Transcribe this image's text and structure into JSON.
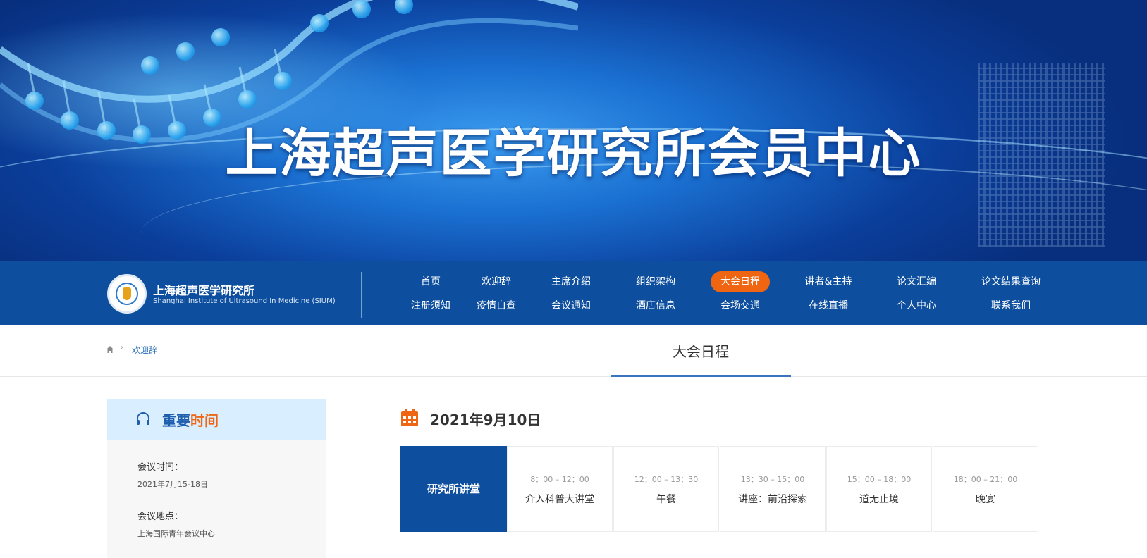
{
  "banner": {
    "title": "上海超声医学研究所会员中心"
  },
  "brand": {
    "name_cn": "上海超声医学研究所",
    "name_en": "Shanghai Institute of Ultrasound In Medicine (SIUM)"
  },
  "nav": {
    "row1": [
      "首页",
      "欢迎辞",
      "主席介绍",
      "组织架构",
      "大会日程",
      "讲者&主持",
      "论文汇编",
      "论文结果查询"
    ],
    "row2": [
      "注册须知",
      "疫情自查",
      "会议通知",
      "酒店信息",
      "会场交通",
      "在线直播",
      "个人中心",
      "联系我们"
    ],
    "active": "大会日程"
  },
  "breadcrumb": {
    "current": "欢迎辞"
  },
  "section": {
    "title": "大会日程"
  },
  "sidebar": {
    "title_part1": "重要",
    "title_part2": "时间",
    "items": [
      {
        "label": "会议时间：",
        "value": "2021年7月15-18日"
      },
      {
        "label": "会议地点：",
        "value": "上海国际青年会议中心"
      }
    ]
  },
  "schedule": {
    "date": "2021年9月10日",
    "track": "研究所讲堂",
    "sessions": [
      {
        "time": "8：00 – 12：00",
        "name": "介入科普大讲堂"
      },
      {
        "time": "12：00 – 13：30",
        "name": "午餐"
      },
      {
        "time": "13：30 – 15：00",
        "name": "讲座：前沿探索"
      },
      {
        "time": "15：00 – 18：00",
        "name": "道无止境"
      },
      {
        "time": "18：00 – 21：00",
        "name": "晚宴"
      }
    ]
  },
  "colors": {
    "nav_bg": "#0d4f9e",
    "accent": "#ef6512",
    "sidebar_head_bg": "#d9efff",
    "link": "#2d6fb9"
  }
}
